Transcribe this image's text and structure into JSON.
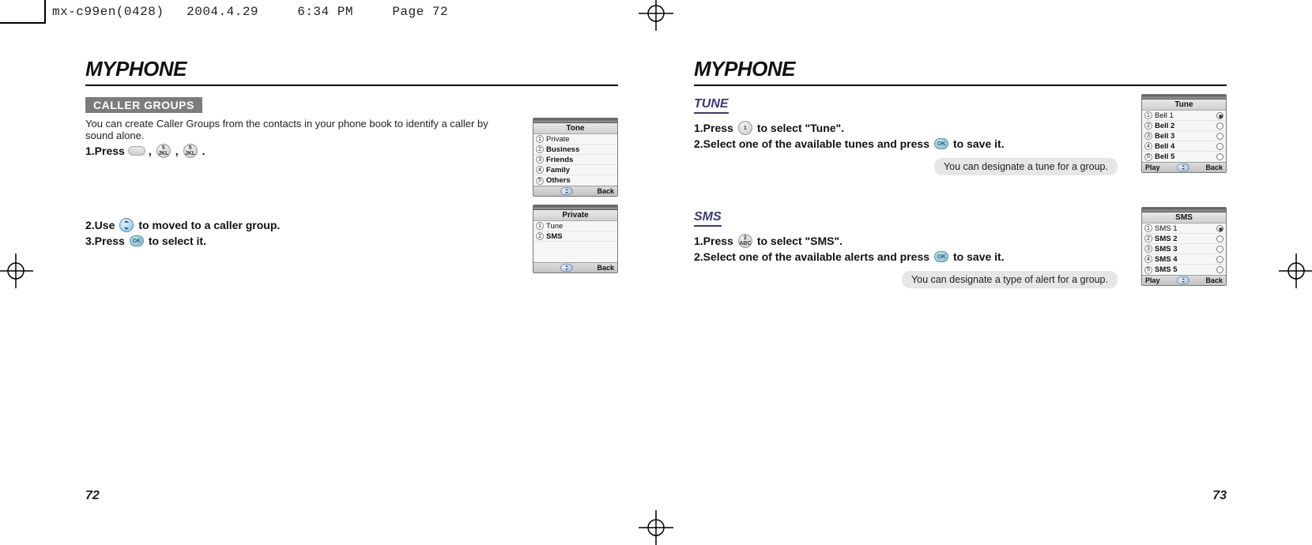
{
  "print_header": {
    "filename": "mx-c99en(0428)",
    "date": "2004.4.29",
    "time": "6:34 PM",
    "page_label": "Page 72"
  },
  "left": {
    "title": "MYPHONE",
    "section": "CALLER GROUPS",
    "intro": "You can create Caller Groups from the contacts in your phone book to identify a caller by sound alone.",
    "step1_prefix": "1.Press",
    "key_menu_label": "Menu",
    "key_5_label": "5\nJKL",
    "step1_suffix": ".",
    "step2": "2.Use         to moved to a caller group.",
    "step2_pre": "2.Use",
    "step2_post": "to moved to a caller group.",
    "step3_pre": "3.Press",
    "step3_post": "to select it.",
    "screen_tone": {
      "title": "Tone",
      "items": [
        "Private",
        "Business",
        "Friends",
        "Family",
        "Others"
      ],
      "foot_right": "Back"
    },
    "screen_private": {
      "title": "Private",
      "items": [
        "Tune",
        "SMS"
      ],
      "foot_right": "Back"
    },
    "page_number": "72"
  },
  "right": {
    "title": "MYPHONE",
    "tune": {
      "heading": "TUNE",
      "step1_pre": "1.Press",
      "step1_post": "to select \"Tune\".",
      "step2_pre": "2.Select one of the available tunes and press",
      "step2_post": "to save it.",
      "note": "You can designate a tune for a group.",
      "screen": {
        "title": "Tune",
        "items": [
          "Bell 1",
          "Bell 2",
          "Bell 3",
          "Bell 4",
          "Bell 5"
        ],
        "foot_left": "Play",
        "foot_right": "Back",
        "selected_index": 0
      },
      "key_1_label": "1"
    },
    "sms": {
      "heading": "SMS",
      "step1_pre": "1.Press",
      "step1_post": "to select \"SMS\".",
      "step2_pre": "2.Select one of the available alerts and press",
      "step2_post": "to save it.",
      "note": "You can designate a type of alert for a group.",
      "screen": {
        "title": "SMS",
        "items": [
          "SMS 1",
          "SMS 2",
          "SMS 3",
          "SMS 4",
          "SMS 5"
        ],
        "foot_left": "Play",
        "foot_right": "Back",
        "selected_index": 0
      },
      "key_2_label": "2\nABC"
    },
    "ok_label": "OK",
    "page_number": "73"
  }
}
